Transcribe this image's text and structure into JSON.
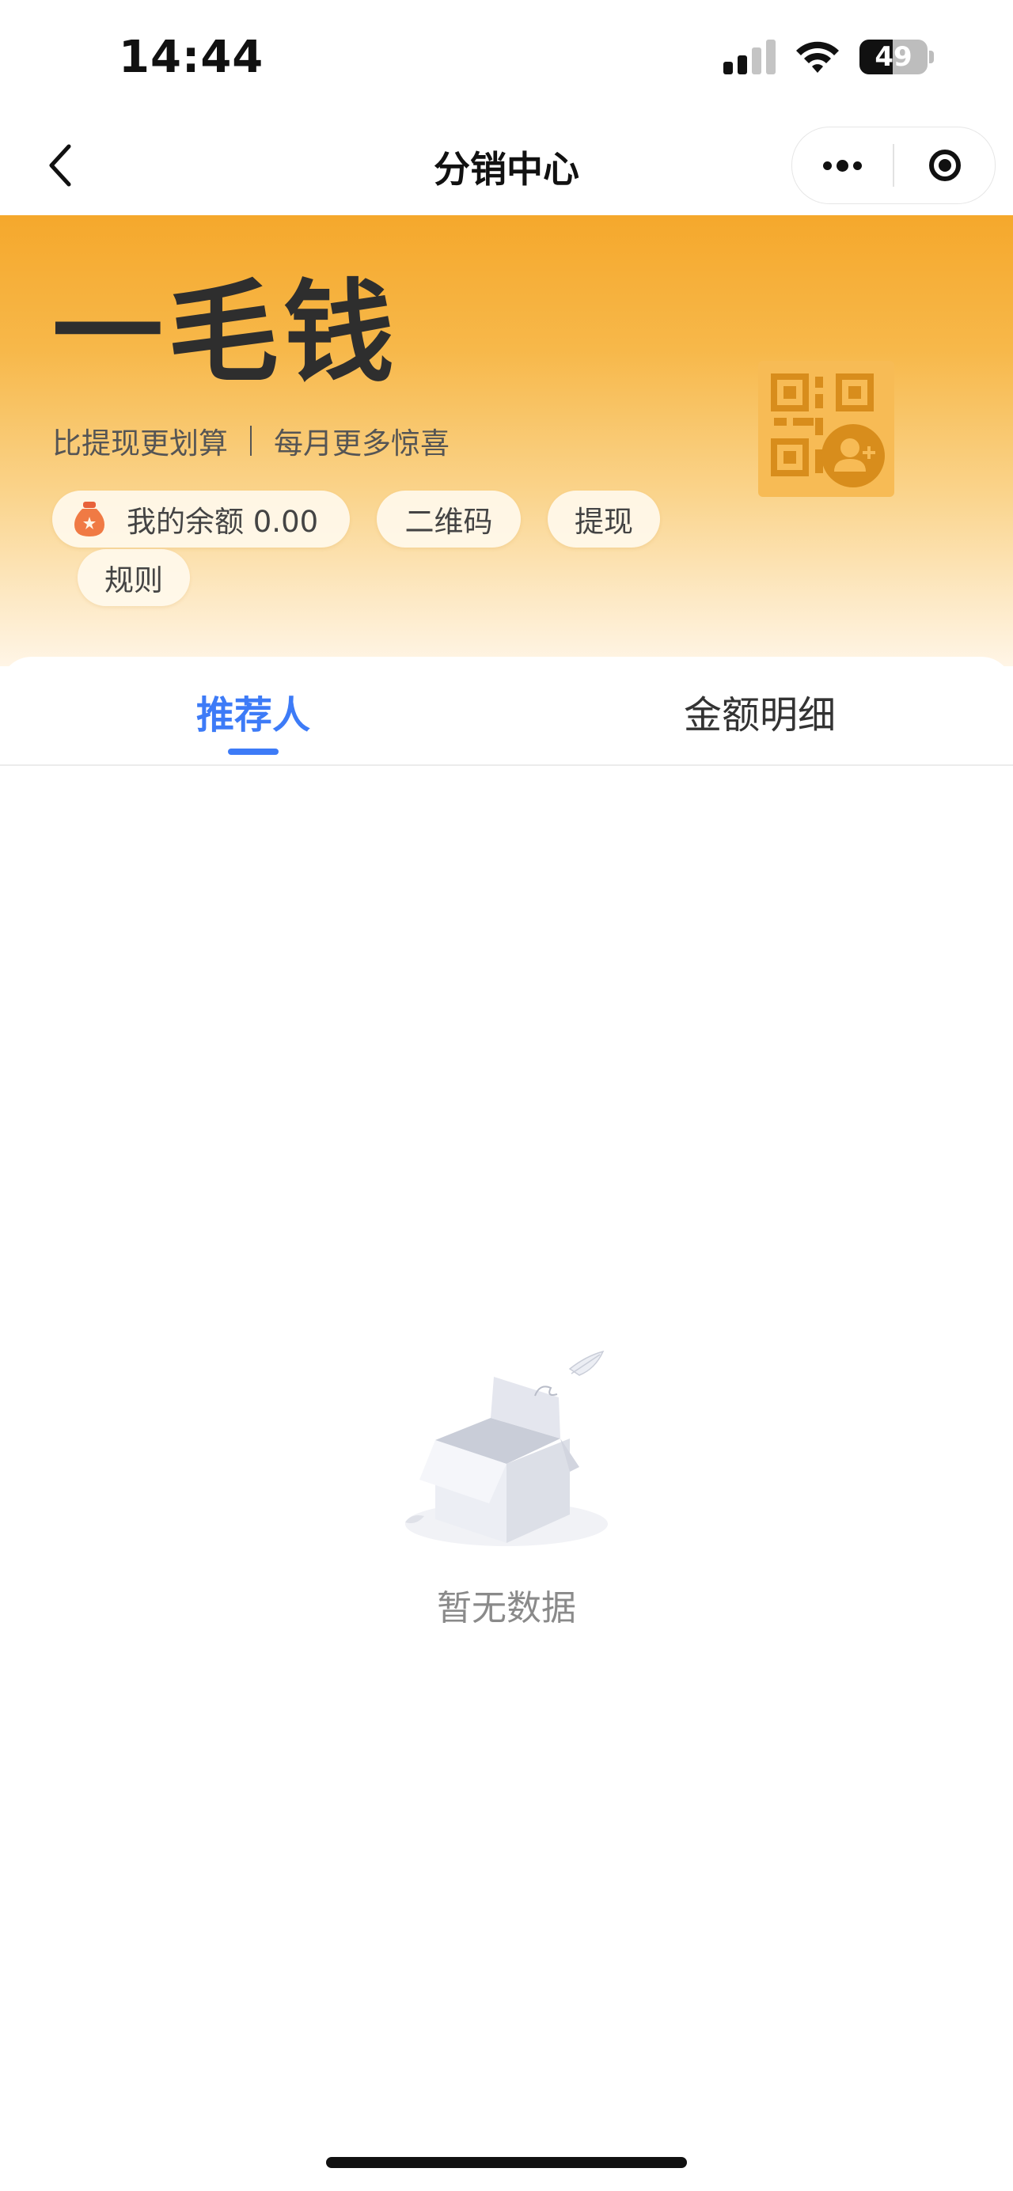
{
  "status_bar": {
    "time": "14:44",
    "battery_percent": 49,
    "battery_label": "49",
    "signal_bars_active": 2,
    "icons": [
      "cellular-signal-icon",
      "wifi-icon",
      "battery-icon"
    ]
  },
  "nav": {
    "title": "分销中心",
    "back_icon": "chevron-left-icon",
    "more_icon": "more-dots-icon",
    "target_icon": "target-circle-icon"
  },
  "banner": {
    "title": "一毛钱",
    "subtitle_left": "比提现更划算",
    "subtitle_right": "每月更多惊喜",
    "balance_label": "我的余额 0.00",
    "qr_button": "二维码",
    "withdraw_button": "提现",
    "rules_button": "规则",
    "qr_card_icon": "qr-code-add-user-icon",
    "colors": {
      "gradient_top": "#f5a82c",
      "gradient_bottom": "#fff5e6",
      "qr_card": "#f7bb55",
      "qr_mark": "#d88d1c"
    }
  },
  "tabs": [
    {
      "label": "推荐人",
      "active": true
    },
    {
      "label": "金额明细",
      "active": false
    }
  ],
  "accent_color": "#3d7bf7",
  "empty_state": {
    "text": "暂无数据",
    "icon": "empty-box-icon"
  }
}
